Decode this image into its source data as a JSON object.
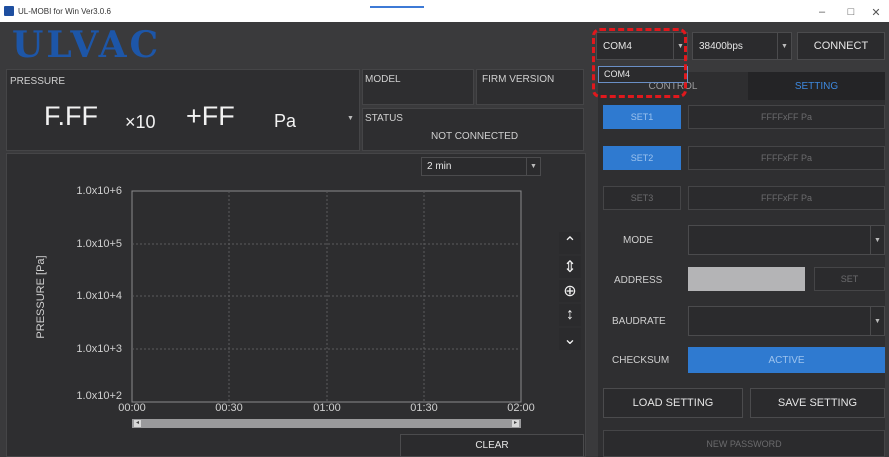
{
  "window": {
    "title": "UL-MOBI for Win Ver3.0.6",
    "minimize": "–",
    "maximize": "□",
    "close": "✕"
  },
  "brand": {
    "logo": "ULVAC"
  },
  "connection": {
    "port": "COM4",
    "baud": "38400bps",
    "connect_label": "CONNECT",
    "dropdown_items": [
      "COM4"
    ]
  },
  "tabs": {
    "control": "CONTROL",
    "setting": "SETTING"
  },
  "pressure": {
    "label": "PRESSURE",
    "mantissa": "F.FF",
    "times": "×10",
    "exponent": "+FF",
    "unit": "Pa"
  },
  "info": {
    "model_label": "MODEL",
    "firm_label": "FIRM VERSION",
    "status_label": "STATUS",
    "status_value": "NOT CONNECTED"
  },
  "graph": {
    "time_range": "2 min",
    "clear_label": "CLEAR",
    "y_axis_label": "PRESSURE [Pa]",
    "y_ticks": [
      "1.0x10+6",
      "1.0x10+5",
      "1.0x10+4",
      "1.0x10+3",
      "1.0x10+2"
    ],
    "x_ticks": [
      "00:00",
      "00:30",
      "01:00",
      "01:30",
      "02:00"
    ]
  },
  "setpoints": [
    {
      "label": "SET1",
      "value": "FFFFxFF Pa"
    },
    {
      "label": "SET2",
      "value": "FFFFxFF Pa"
    },
    {
      "label": "SET3",
      "value": "FFFFxFF Pa"
    }
  ],
  "settings": {
    "mode_label": "MODE",
    "address_label": "ADDRESS",
    "address_set": "SET",
    "baudrate_label": "BAUDRATE",
    "checksum_label": "CHECKSUM",
    "checksum_value": "ACTIVE",
    "load_label": "LOAD SETTING",
    "save_label": "SAVE SETTING",
    "new_password": "NEW PASSWORD"
  },
  "colors": {
    "accent": "#2f7ad0",
    "brand": "#1d56a8",
    "highlight": "#e0181d"
  }
}
